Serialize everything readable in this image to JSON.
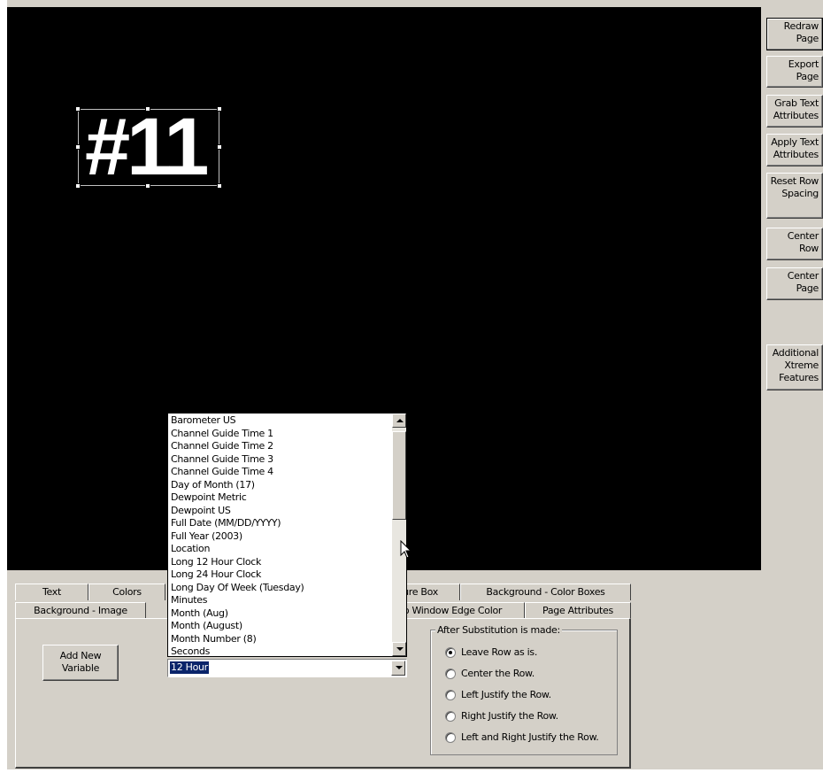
{
  "side_buttons": [
    {
      "label": "Redraw Page"
    },
    {
      "label": "Export Page"
    },
    {
      "label": "Grab Text Attributes"
    },
    {
      "label": "Apply Text Attributes"
    },
    {
      "label": "Reset Row Spacing"
    },
    {
      "label": "Center Row"
    },
    {
      "label": "Center Page"
    },
    {
      "label": "Additional Xtreme Features"
    }
  ],
  "canvas": {
    "text": "#11"
  },
  "tabs": {
    "row1": [
      "Text",
      "Colors",
      "",
      "ure Box",
      "Background - Color Boxes"
    ],
    "row2": [
      "Background - Image",
      "",
      "o Window Edge Color",
      "Page Attributes"
    ]
  },
  "add_variable_button": "Add New Variable",
  "variable_list": {
    "items": [
      "Barometer US",
      "Channel Guide Time 1",
      "Channel Guide Time 2",
      "Channel Guide Time 3",
      "Channel Guide Time 4",
      "Day of Month (17)",
      "Dewpoint Metric",
      "Dewpoint US",
      "Full Date (MM/DD/YYYY)",
      "Full Year (2003)",
      "Location",
      "Long 12 Hour Clock",
      "Long 24 Hour Clock",
      "Long Day Of Week (Tuesday)",
      "Minutes",
      "Month (Aug)",
      "Month (August)",
      "Month Number (8)",
      "Seconds"
    ],
    "selected_value": "12 Hour"
  },
  "substitution_group": {
    "title": "After Substitution is made:",
    "options": [
      "Leave Row as is.",
      "Center the Row.",
      "Left Justify the Row.",
      "Right Justify the Row.",
      "Left and Right Justify the Row."
    ],
    "selected_index": 0
  }
}
